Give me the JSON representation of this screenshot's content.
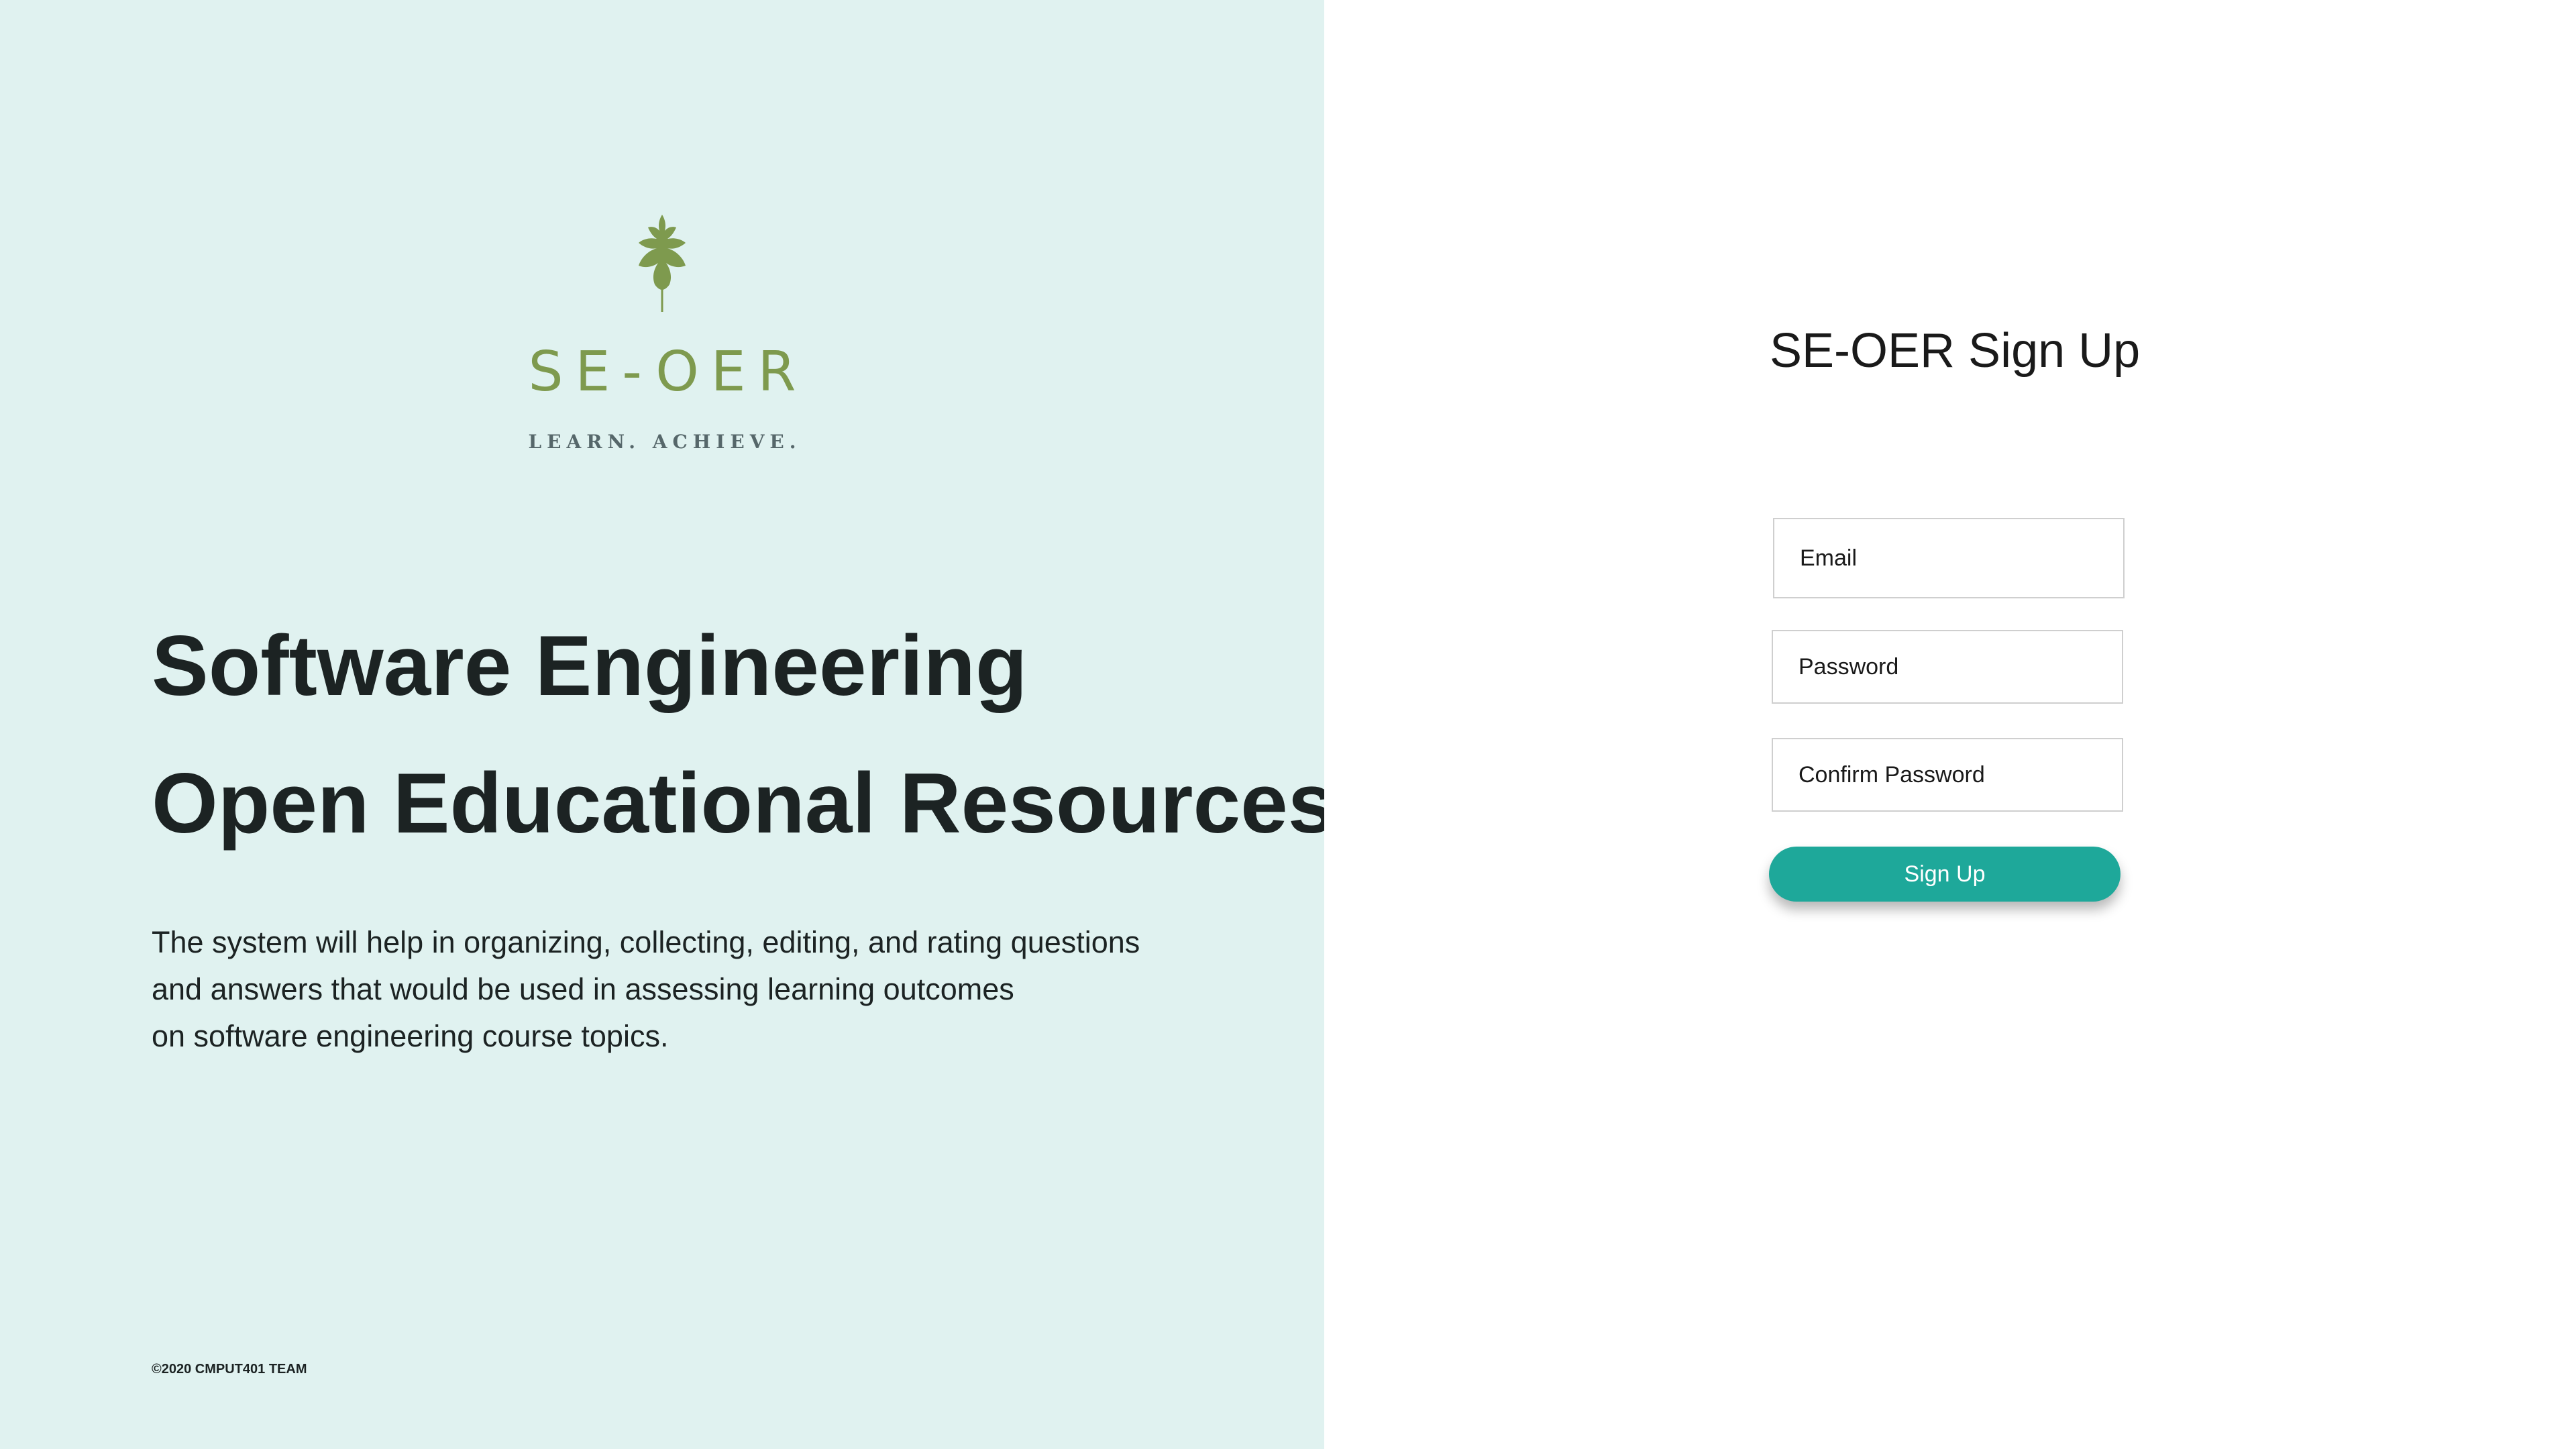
{
  "brand": {
    "name": "SE-OER",
    "tagline": "LEARN. ACHIEVE.",
    "logo_icon": "leaf-icon",
    "logo_color": "#7e9a4e"
  },
  "hero": {
    "headline_line1": "Software Engineering",
    "headline_line2": "Open Educational Resources",
    "description_line1": "The system will help in organizing, collecting, editing, and rating questions",
    "description_line2": "and answers that would be used in assessing learning outcomes",
    "description_line3": "on software engineering course topics."
  },
  "footer": {
    "copyright": "©2020 CMPUT401 TEAM"
  },
  "signup_form": {
    "title": "SE-OER Sign Up",
    "email_placeholder": "Email",
    "password_placeholder": "Password",
    "confirm_password_placeholder": "Confirm Password",
    "submit_label": "Sign Up"
  },
  "colors": {
    "left_panel_bg": "#e0f2f0",
    "accent": "#1ea89a",
    "heading_text": "#1c2323"
  }
}
